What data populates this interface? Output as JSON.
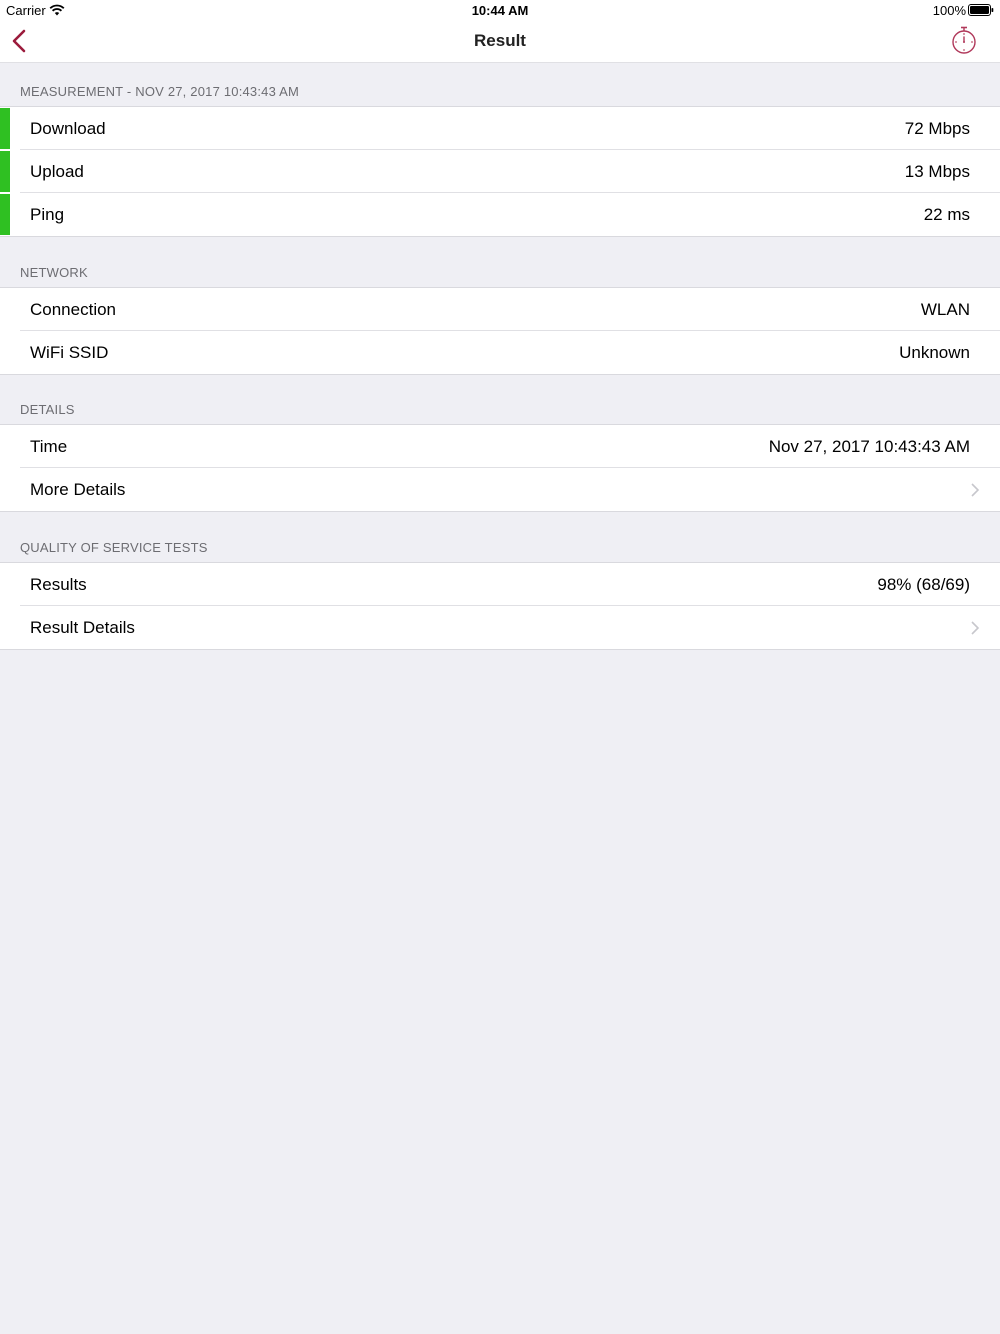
{
  "status_bar": {
    "carrier": "Carrier",
    "time": "10:44 AM",
    "battery": "100%"
  },
  "nav": {
    "title": "Result",
    "back_icon": "chevron-left-icon",
    "action_icon": "stopwatch-icon",
    "accent_color": "#9b1b3c"
  },
  "measurement": {
    "header": "MEASUREMENT - NOV 27, 2017 10:43:43 AM",
    "indicator_color": "#2fc022",
    "rows": [
      {
        "label": "Download",
        "value": "72 Mbps"
      },
      {
        "label": "Upload",
        "value": "13 Mbps"
      },
      {
        "label": "Ping",
        "value": "22 ms"
      }
    ]
  },
  "network": {
    "header": "NETWORK",
    "rows": [
      {
        "label": "Connection",
        "value": "WLAN"
      },
      {
        "label": "WiFi SSID",
        "value": "Unknown"
      }
    ]
  },
  "details": {
    "header": "DETAILS",
    "rows": [
      {
        "label": "Time",
        "value": "Nov 27, 2017 10:43:43 AM"
      },
      {
        "label": "More Details"
      }
    ]
  },
  "qos": {
    "header": "QUALITY OF SERVICE TESTS",
    "rows": [
      {
        "label": "Results",
        "value": "98% (68/69)"
      },
      {
        "label": "Result Details"
      }
    ]
  }
}
